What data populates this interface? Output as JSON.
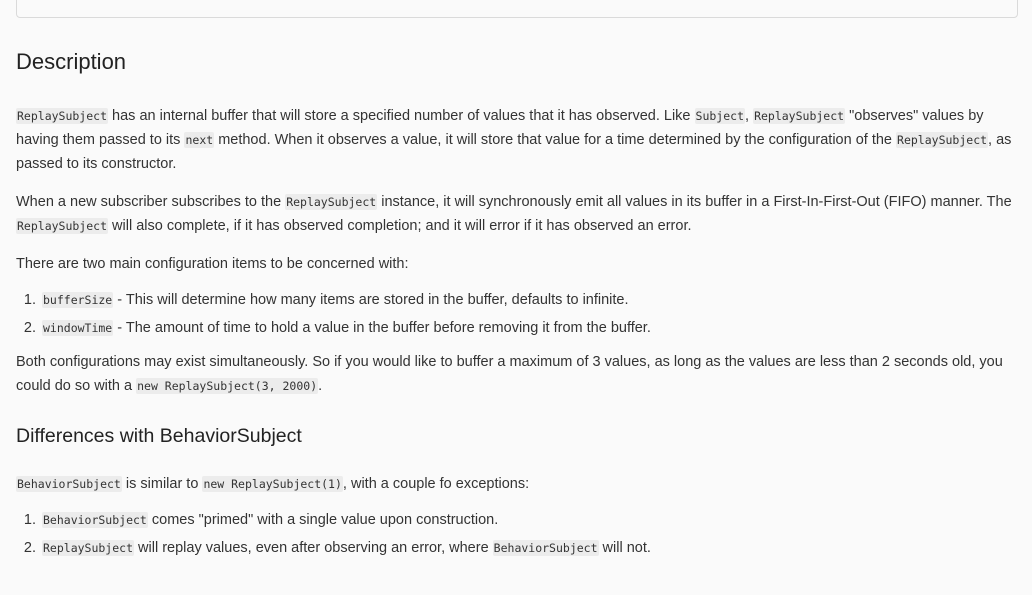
{
  "heading_description": "Description",
  "p1": {
    "c1": "ReplaySubject",
    "t1": " has an internal buffer that will store a specified number of values that it has observed. Like ",
    "c2": "Subject",
    "t2": ", ",
    "c3": "ReplaySubject",
    "t3": " \"observes\" values by having them passed to its ",
    "c4": "next",
    "t4": " method. When it observes a value, it will store that value for a time determined by the configuration of the ",
    "c5": "ReplaySubject",
    "t5": ", as passed to its constructor."
  },
  "p2": {
    "t1": "When a new subscriber subscribes to the ",
    "c1": "ReplaySubject",
    "t2": " instance, it will synchronously emit all values in its buffer in a First-In-First-Out (FIFO) manner. The ",
    "c2": "ReplaySubject",
    "t3": " will also complete, if it has observed completion; and it will error if it has observed an error."
  },
  "p3": "There are two main configuration items to be concerned with:",
  "config_items": [
    {
      "code": "bufferSize",
      "text": " - This will determine how many items are stored in the buffer, defaults to infinite."
    },
    {
      "code": "windowTime",
      "text": " - The amount of time to hold a value in the buffer before removing it from the buffer."
    }
  ],
  "p4": {
    "t1": "Both configurations may exist simultaneously. So if you would like to buffer a maximum of 3 values, as long as the values are less than 2 seconds old, you could do so with a ",
    "c1": "new ReplaySubject(3, 2000)",
    "t2": "."
  },
  "heading_differences": "Differences with BehaviorSubject",
  "p5": {
    "c1": "BehaviorSubject",
    "t1": " is similar to ",
    "c2": "new ReplaySubject(1)",
    "t2": ", with a couple fo exceptions:"
  },
  "exceptions": [
    {
      "c1": "BehaviorSubject",
      "t1": " comes \"primed\" with a single value upon construction.",
      "c2": "",
      "t2": ""
    },
    {
      "c1": "ReplaySubject",
      "t1": " will replay values, even after observing an error, where ",
      "c2": "BehaviorSubject",
      "t2": " will not."
    }
  ]
}
